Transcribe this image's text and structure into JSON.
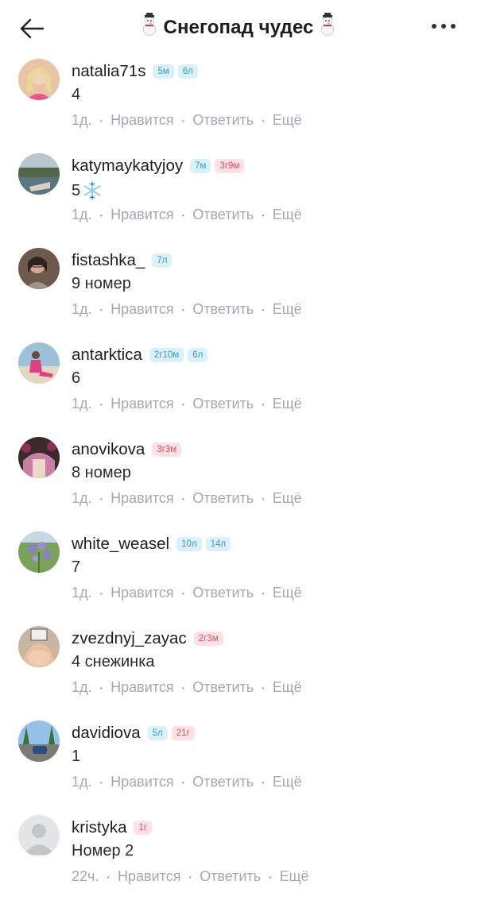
{
  "header": {
    "title": "Снегопад чудес",
    "title_icon": "snowman-emoji",
    "back_icon": "arrow-left-icon",
    "more_icon": "more-dots-icon"
  },
  "actions": {
    "like": "Нравится",
    "reply": "Ответить",
    "more": "Ещё"
  },
  "comments": [
    {
      "username": "natalia71s",
      "badges": [
        {
          "text": "5м",
          "color": "blue"
        },
        {
          "text": "6л",
          "color": "blue"
        }
      ],
      "text": "4",
      "emoji": "",
      "time": "1д."
    },
    {
      "username": "katymaykatyjoy",
      "badges": [
        {
          "text": "7м",
          "color": "blue"
        },
        {
          "text": "3г9м",
          "color": "red"
        }
      ],
      "text": "5",
      "emoji": "snowflake",
      "time": "1д."
    },
    {
      "username": "fistashka_",
      "badges": [
        {
          "text": "7л",
          "color": "blue"
        }
      ],
      "text": "9 номер",
      "emoji": "",
      "time": "1д."
    },
    {
      "username": "antarktica",
      "badges": [
        {
          "text": "2г10м",
          "color": "blue"
        },
        {
          "text": "6л",
          "color": "blue"
        }
      ],
      "text": "6",
      "emoji": "",
      "time": "1д."
    },
    {
      "username": "anovikova",
      "badges": [
        {
          "text": "3г3м",
          "color": "red"
        }
      ],
      "text": "8 номер",
      "emoji": "",
      "time": "1д."
    },
    {
      "username": "white_weasel",
      "badges": [
        {
          "text": "10л",
          "color": "blue"
        },
        {
          "text": "14л",
          "color": "blue"
        }
      ],
      "text": "7",
      "emoji": "",
      "time": "1д."
    },
    {
      "username": "zvezdnyj_zayac",
      "badges": [
        {
          "text": "2г3м",
          "color": "red"
        }
      ],
      "text": "4 снежинка",
      "emoji": "",
      "time": "1д."
    },
    {
      "username": "davidiova",
      "badges": [
        {
          "text": "5л",
          "color": "blue"
        },
        {
          "text": "21г",
          "color": "red"
        }
      ],
      "text": "1",
      "emoji": "",
      "time": "1д."
    },
    {
      "username": "kristyka",
      "badges": [
        {
          "text": "1г",
          "color": "red"
        }
      ],
      "text": "Номер 2",
      "emoji": "",
      "time": "22ч."
    }
  ],
  "colors": {
    "blue_badge_bg": "#d9f1fb",
    "blue_badge_text": "#3b98c4",
    "red_badge_bg": "#fde1e4",
    "red_badge_text": "#d8505f",
    "meta": "#a4a9b0"
  }
}
